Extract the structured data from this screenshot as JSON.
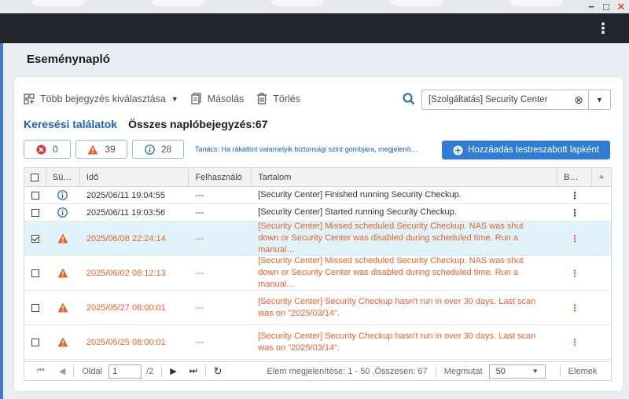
{
  "window": {
    "minimize": "−",
    "maximize": "□",
    "close": "✕"
  },
  "page_title": "Eseménynapló",
  "toolbar": {
    "select_multiple": "Több bejegyzés kiválasztása",
    "copy": "Másolás",
    "delete": "Törlés"
  },
  "search": {
    "value": "[Szolgáltatás] Security Center"
  },
  "results": {
    "label": "Keresési találatok",
    "total": "Összes naplóbejegyzés:67"
  },
  "filters": {
    "error_count": "0",
    "warning_count": "39",
    "info_count": "28"
  },
  "hint": "Tanács: Ha rákattint valamelyik biztonsági szint gombjára, megjelenít…",
  "add_tab_button": "Hozzáadás testreszabott lapként",
  "columns": [
    "Sú…",
    "Idő",
    "Felhasználó",
    "Tartalom",
    "B…",
    "+"
  ],
  "rows": [
    {
      "level": "info",
      "time": "2025/06/11 19:04:55",
      "user": "---",
      "content": "[Security Center] Finished running Security Checkup.",
      "checked": false
    },
    {
      "level": "info",
      "time": "2025/06/11 19:03:56",
      "user": "---",
      "content": "[Security Center] Started running Security Checkup.",
      "checked": false
    },
    {
      "level": "warning",
      "time": "2025/06/08 22:24:14",
      "user": "---",
      "content": "[Security Center] Missed scheduled Security Checkup. NAS was shut down or Security Center was disabled during scheduled time. Run a manual…",
      "checked": true
    },
    {
      "level": "warning",
      "time": "2025/06/02 08:12:13",
      "user": "---",
      "content": "[Security Center] Missed scheduled Security Checkup. NAS was shut down or Security Center was disabled during scheduled time. Run a manual…",
      "checked": false
    },
    {
      "level": "warning",
      "time": "2025/05/27 08:00:01",
      "user": "---",
      "content": "[Security Center] Security Checkup hasn't run in over 30 days. Last scan was on \"2025/03/14\".",
      "checked": false
    },
    {
      "level": "warning",
      "time": "2025/05/25 08:00:01",
      "user": "---",
      "content": "[Security Center] Security Checkup hasn't run in over 30 days. Last scan was on \"2025/03/14\".",
      "checked": false
    }
  ],
  "pager": {
    "page_label": "Oldal",
    "page_value": "1",
    "page_total": "/2",
    "display_info": "Elem megjelenítése: 1 - 50 ,Összesen: 67",
    "show_label": "Megmutat",
    "page_size": "50",
    "items_label": "Elemek"
  },
  "colors": {
    "accent": "#2f7dd4",
    "warning": "#e8622a",
    "error": "#d9363e",
    "info": "#1f62b5",
    "selected_row": "#e0f3fb"
  }
}
